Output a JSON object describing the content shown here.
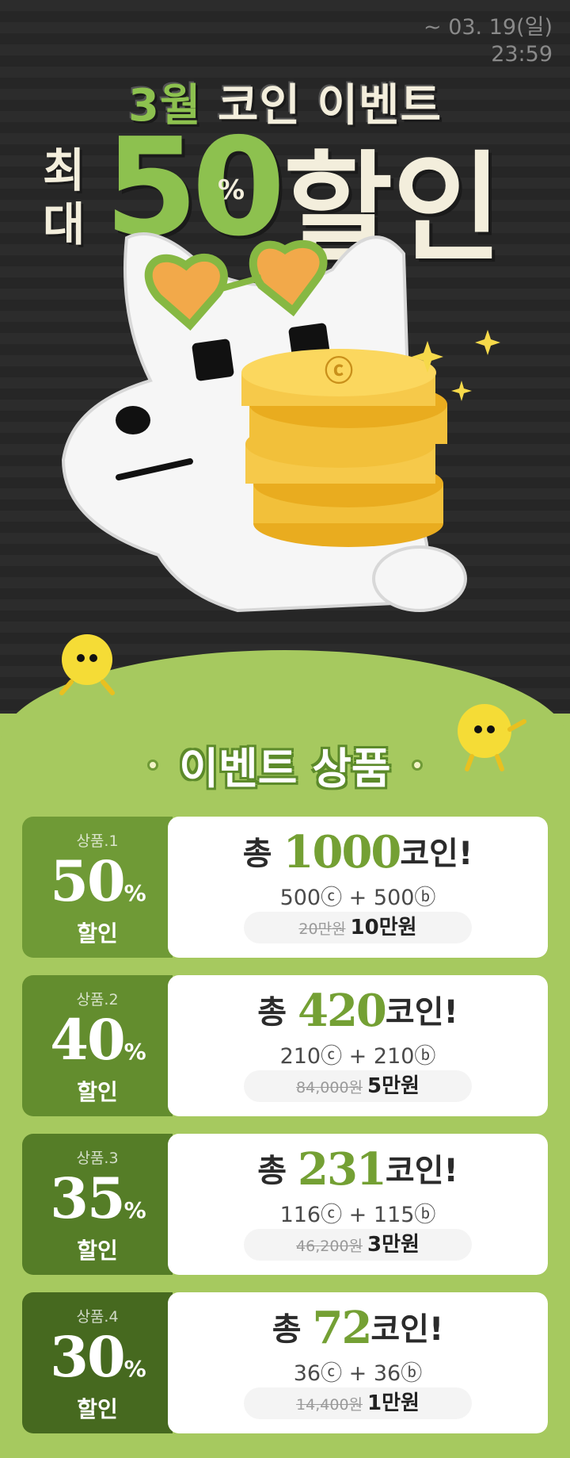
{
  "deadline": {
    "date": "~ 03. 19(일)",
    "time": "23:59"
  },
  "headline": {
    "part1": "3월",
    "part2": "코인 이벤트",
    "prefix_top": "최",
    "prefix_bottom": "대",
    "number": "50",
    "percent": "%",
    "word": "할인"
  },
  "section_title": "이벤트 상품",
  "products": [
    {
      "label": "상품.1",
      "percent": "50",
      "pct_sign": "%",
      "discount": "할인",
      "total_prefix": "총",
      "coins": "1000",
      "coin_word": "코인!",
      "split": "500ⓒ + 500ⓑ",
      "old_price": "20만원",
      "new_price": "10만원"
    },
    {
      "label": "상품.2",
      "percent": "40",
      "pct_sign": "%",
      "discount": "할인",
      "total_prefix": "총",
      "coins": "420",
      "coin_word": "코인!",
      "split": "210ⓒ + 210ⓑ",
      "old_price": "84,000원",
      "new_price": "5만원"
    },
    {
      "label": "상품.3",
      "percent": "35",
      "pct_sign": "%",
      "discount": "할인",
      "total_prefix": "총",
      "coins": "231",
      "coin_word": "코인!",
      "split": "116ⓒ + 115ⓑ",
      "old_price": "46,200원",
      "new_price": "3만원"
    },
    {
      "label": "상품.4",
      "percent": "30",
      "pct_sign": "%",
      "discount": "할인",
      "total_prefix": "총",
      "coins": "72",
      "coin_word": "코인!",
      "split": "36ⓒ + 36ⓑ",
      "old_price": "14,400원",
      "new_price": "1만원"
    }
  ],
  "colors": {
    "card1": "#6f9a36",
    "card2": "#638d2e",
    "card3": "#557d27",
    "card4": "#46691f",
    "accent": "#8dc14f",
    "ground": "#a6c95f"
  }
}
